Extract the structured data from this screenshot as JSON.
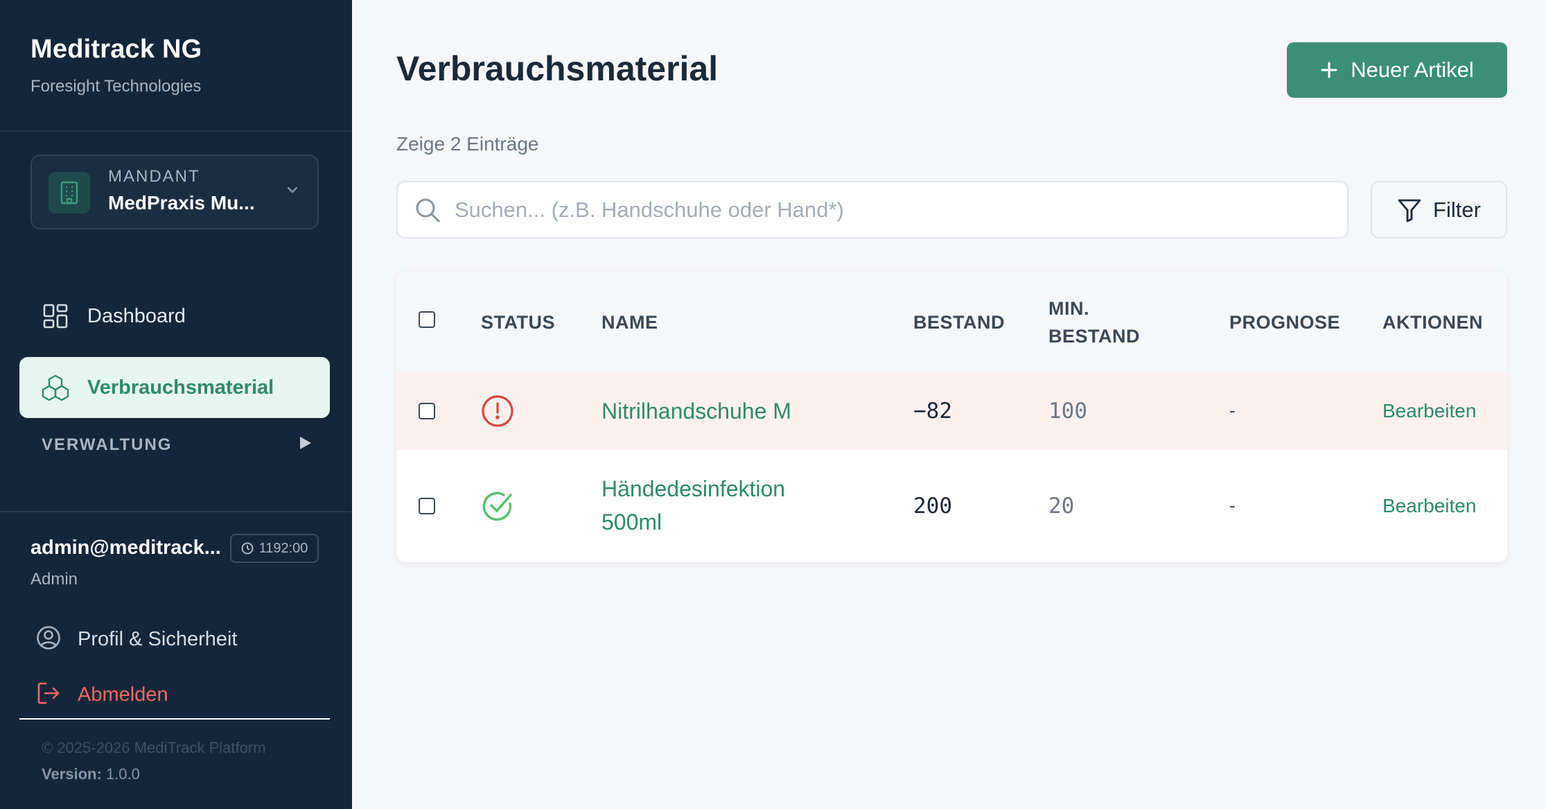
{
  "app": {
    "title": "Meditrack NG",
    "subtitle": "Foresight Technologies"
  },
  "tenant": {
    "caption": "MANDANT",
    "name": "MedPraxis Mu..."
  },
  "nav": {
    "dashboard": "Dashboard",
    "supplies": "Verbrauchsmaterial",
    "admin_section": "VERWALTUNG"
  },
  "user": {
    "email": "admin@meditrack...",
    "session_time": "1192:00",
    "role": "Admin",
    "profile_link": "Profil & Sicherheit",
    "logout_link": "Abmelden"
  },
  "footer": {
    "copyright": "© 2025-2026 MediTrack Platform",
    "version_label": "Version:",
    "version_value": "1.0.0"
  },
  "page": {
    "title": "Verbrauchsmaterial",
    "new_button": "Neuer Artikel",
    "entry_count": "Zeige 2 Einträge"
  },
  "search": {
    "placeholder": "Suchen... (z.B. Handschuhe oder Hand*)",
    "filter_label": "Filter"
  },
  "table": {
    "columns": {
      "status": "STATUS",
      "name": "NAME",
      "stock": "BESTAND",
      "min_stock_line1": "MIN.",
      "min_stock_line2": "BESTAND",
      "forecast": "PROGNOSE",
      "actions": "AKTIONEN"
    },
    "rows": [
      {
        "status": "alert",
        "name": "Nitrilhandschuhe M",
        "stock": "−82",
        "min_stock": "100",
        "forecast": "-",
        "action": "Bearbeiten"
      },
      {
        "status": "ok",
        "name_line1": "Händedesinfektion",
        "name_line2": "500ml",
        "stock": "200",
        "min_stock": "20",
        "forecast": "-",
        "action": "Bearbeiten"
      }
    ]
  },
  "colors": {
    "sidebar_bg": "#14263a",
    "accent": "#3b8f77",
    "alert": "#d64a43",
    "ok": "#5bbf6a",
    "alert_row_bg": "#fdf1f0"
  }
}
